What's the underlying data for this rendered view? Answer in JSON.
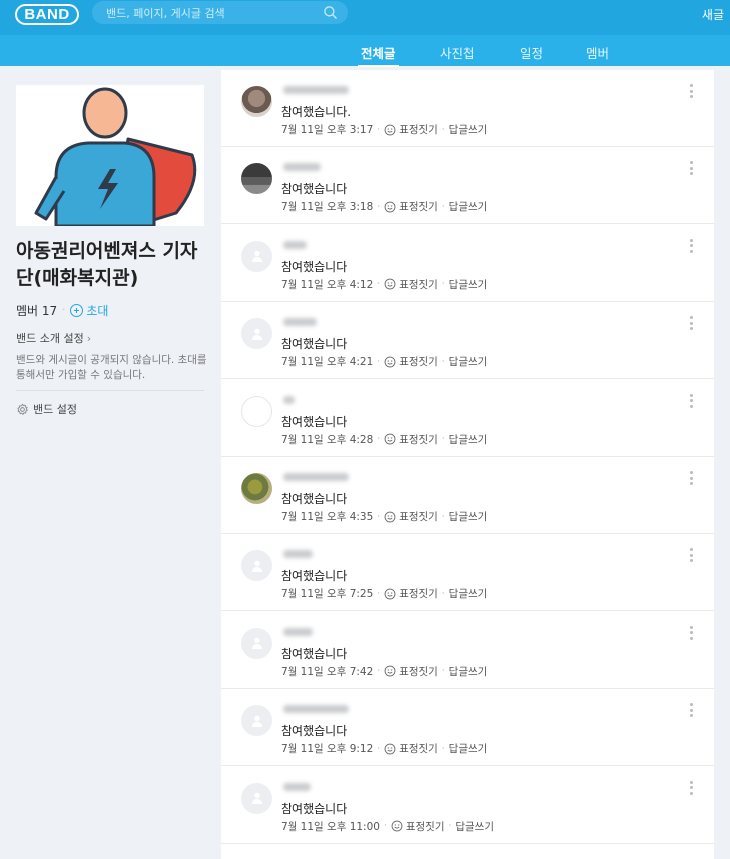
{
  "header": {
    "logo": "BAND",
    "search_placeholder": "밴드, 페이지, 게시글 검색",
    "new_post": "새글"
  },
  "tabs": [
    {
      "label": "전체글",
      "active": true
    },
    {
      "label": "사진첩",
      "active": false
    },
    {
      "label": "일정",
      "active": false
    },
    {
      "label": "멤버",
      "active": false
    }
  ],
  "sidebar": {
    "band_name": "아동권리어벤져스 기자단(매화복지관)",
    "member_label": "멤버 17",
    "invite_label": "초대",
    "intro_setting": "밴드 소개 설정",
    "notice": "밴드와 게시글이 공개되지 않습니다. 초대를 통해서만 가입할 수 있습니다.",
    "band_setting": "밴드 설정"
  },
  "comment_actions": {
    "react": "표정짓기",
    "reply": "답글쓰기"
  },
  "comments": [
    {
      "avatar": "photo1",
      "text": "참여했습니다.",
      "time": "7월 11일 오후 3:17"
    },
    {
      "avatar": "photo2",
      "text": "참여했습니다",
      "time": "7월 11일 오후 3:18"
    },
    {
      "avatar": "default",
      "text": "참여했습니다",
      "time": "7월 11일 오후 4:12"
    },
    {
      "avatar": "default",
      "text": "참여했습니다",
      "time": "7월 11일 오후 4:21"
    },
    {
      "avatar": "blank",
      "text": "참여했습니다",
      "time": "7월 11일 오후 4:28"
    },
    {
      "avatar": "photo3",
      "text": "참여했습니다",
      "time": "7월 11일 오후 4:35"
    },
    {
      "avatar": "default",
      "text": "참여했습니다",
      "time": "7월 11일 오후 7:25"
    },
    {
      "avatar": "default",
      "text": "참여했습니다",
      "time": "7월 11일 오후 7:42"
    },
    {
      "avatar": "default",
      "text": "참여했습니다",
      "time": "7월 11일 오후 9:12"
    },
    {
      "avatar": "default",
      "text": "참여했습니다",
      "time": "7월 11일 오후 11:00"
    }
  ],
  "colors": {
    "brand": "#22a6e0",
    "tabbar": "#2bb1e9",
    "background": "#eef1f5"
  }
}
